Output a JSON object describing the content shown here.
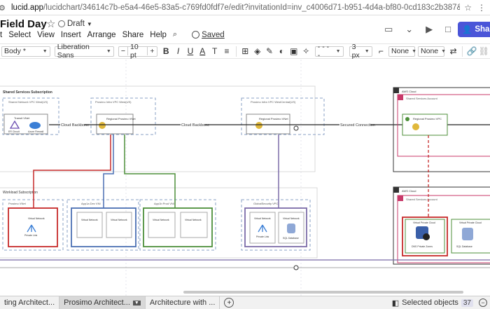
{
  "browser": {
    "url_host": "lucid.app",
    "url_rest": "/lucidchart/34614c7b-e5a4-46e5-83a5-c769fd0fdf7e/edit?invitationId=inv_c4006d71-b951-4d4a-bf80-0cd183c2b387&referringApp=slack&page=S~P..."
  },
  "document": {
    "title": "Field Day",
    "status": "Draft",
    "saved_label": "Saved",
    "share_label": "Share"
  },
  "menu": [
    "t",
    "Select",
    "View",
    "Insert",
    "Arrange",
    "Share",
    "Help"
  ],
  "toolbar": {
    "style_value": "Body *",
    "font_value": "Liberation Sans",
    "font_size": "10 pt",
    "line_style": "- - - -",
    "line_width": "3 px",
    "arrow_start": "None",
    "arrow_end": "None"
  },
  "diagram": {
    "shared_services_title": "Shared Services Subscription",
    "shared_network_label": "Shared Network VPC West(US)",
    "prosimo_west_label": "Prosimo Infra VPC West(US)",
    "prosimo_central_label": "Prosimo Infra VPC WestCentral(US)",
    "transit_vnet_label": "Transit VNet",
    "regional_vnet_label": "Regional Prosimo VNet",
    "er_circuit_label": "ER Circuit",
    "azure_firewall_label": "Azure Firewall",
    "cloud_backbone_1": "Cloud Backbone",
    "cloud_backbone_2": "Cloud Backbone",
    "secured_connection": "Secured Connection",
    "aws_cloud_label": "AWS Cloud",
    "shared_services_account": "Shared Services Account",
    "regional_vpc_label": "Regional Prosimo VPC",
    "workload_title": "Workload Subscription",
    "prosimo_vnet_label": "Prosimo VNet",
    "app_a_label": "App1a Dev VNI",
    "app_b_label": "App1b Prod VNI",
    "global_vpc_label": "GlobalSecurity VPC",
    "virtual_network": "Virtual Network",
    "private_link": "Private Link",
    "sql_database": "SQL Database",
    "aws_cloud_label_2": "AWS Cloud",
    "shared_services_account_2": "Shared Services Account",
    "virtual_private_cloud": "Virtual Private Cloud",
    "private_zones": "DNS Private Zones"
  },
  "tabs": [
    {
      "label": "ting Architect..."
    },
    {
      "label": "Prosimo Architect..."
    },
    {
      "label": "Architecture with ..."
    }
  ],
  "status": {
    "selected_label": "Selected objects",
    "selected_count": "37"
  },
  "colors": {
    "accent": "#4a55d8",
    "red": "#c62828",
    "blue": "#4a6fb3",
    "green": "#4d8f3a",
    "purple": "#7b6ba8"
  }
}
